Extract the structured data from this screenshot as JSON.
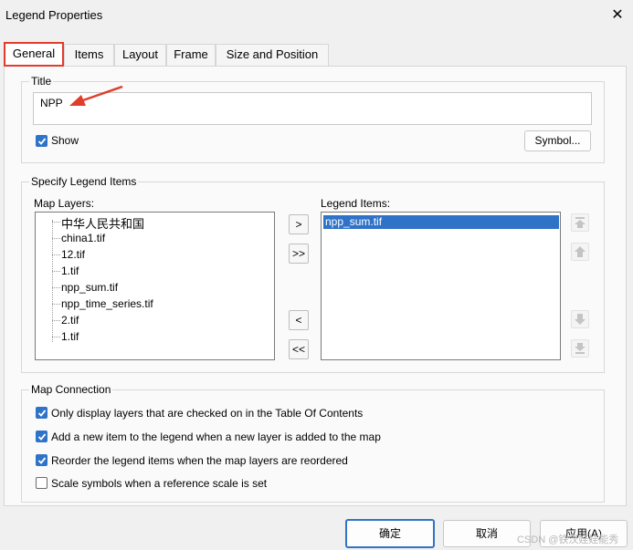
{
  "window": {
    "title": "Legend Properties",
    "close_icon": "close-icon"
  },
  "tabs": [
    {
      "label": "General",
      "active": true
    },
    {
      "label": "Items"
    },
    {
      "label": "Layout"
    },
    {
      "label": "Frame"
    },
    {
      "label": "Size and Position"
    }
  ],
  "title_group": {
    "label": "Title",
    "value": "NPP",
    "show_label": "Show",
    "show_checked": true,
    "symbol_button": "Symbol..."
  },
  "legend_items_group": {
    "label": "Specify Legend Items",
    "map_layers_label": "Map Layers:",
    "map_layers": [
      "中华人民共和国",
      "china1.tif",
      "12.tif",
      "1.tif",
      "npp_sum.tif",
      "npp_time_series.tif",
      "2.tif",
      "1.tif"
    ],
    "legend_items_label": "Legend Items:",
    "legend_items": [
      "npp_sum.tif"
    ],
    "buttons": {
      "add": ">",
      "add_all": ">>",
      "remove": "<",
      "remove_all": "<<"
    }
  },
  "map_connection": {
    "label": "Map Connection",
    "options": [
      {
        "label": "Only display layers that are checked on in the Table Of Contents",
        "checked": true
      },
      {
        "label": "Add a new item to the legend when a new layer is added to the map",
        "checked": true
      },
      {
        "label": "Reorder the legend items when the map layers are reordered",
        "checked": true
      },
      {
        "label": "Scale symbols when a reference scale is set",
        "checked": false
      }
    ]
  },
  "footer": {
    "ok": "确定",
    "cancel": "取消",
    "apply": "应用(A)"
  },
  "watermark": "CSDN @铁汉娃娃能秀",
  "colors": {
    "accent": "#2f73c8",
    "highlight": "#e13d2b"
  }
}
